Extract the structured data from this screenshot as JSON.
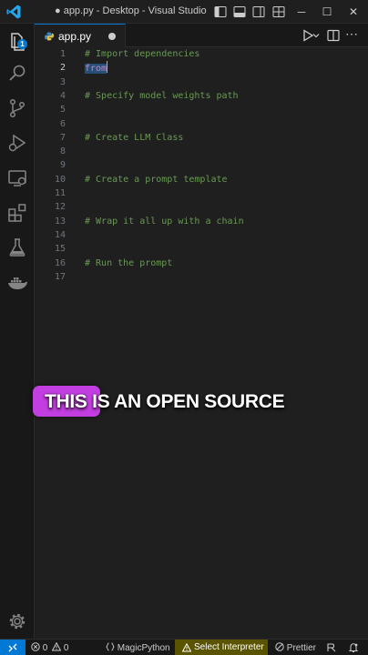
{
  "window": {
    "title": "● app.py - Desktop - Visual Studio C...",
    "controls": {
      "minimize": "─",
      "maximize": "☐",
      "close": "✕"
    }
  },
  "activity_bar": {
    "items": [
      "explorer-icon",
      "search-icon",
      "source-control-icon",
      "run-debug-icon",
      "remote-explorer-icon",
      "extensions-icon",
      "testing-icon",
      "docker-icon"
    ],
    "explorer_badge": "1",
    "bottom_items": [
      "manage-gear-icon"
    ]
  },
  "tabs": [
    {
      "label": "app.py",
      "modified": true,
      "active": true
    }
  ],
  "editor": {
    "lines": [
      {
        "n": "1",
        "text": "# Import dependencies",
        "kind": "comment"
      },
      {
        "n": "2",
        "text": "from",
        "kind": "keyword-selected"
      },
      {
        "n": "3",
        "text": "",
        "kind": "empty"
      },
      {
        "n": "4",
        "text": "# Specify model weights path",
        "kind": "comment"
      },
      {
        "n": "5",
        "text": "",
        "kind": "empty"
      },
      {
        "n": "6",
        "text": "",
        "kind": "empty"
      },
      {
        "n": "7",
        "text": "# Create LLM Class",
        "kind": "comment"
      },
      {
        "n": "8",
        "text": "",
        "kind": "empty"
      },
      {
        "n": "9",
        "text": "",
        "kind": "empty"
      },
      {
        "n": "10",
        "text": "# Create a prompt template",
        "kind": "comment"
      },
      {
        "n": "11",
        "text": "",
        "kind": "empty"
      },
      {
        "n": "12",
        "text": "",
        "kind": "empty"
      },
      {
        "n": "13",
        "text": "# Wrap it all up with a chain",
        "kind": "comment"
      },
      {
        "n": "14",
        "text": "",
        "kind": "empty"
      },
      {
        "n": "15",
        "text": "",
        "kind": "empty"
      },
      {
        "n": "16",
        "text": "# Run the prompt",
        "kind": "comment"
      },
      {
        "n": "17",
        "text": "",
        "kind": "empty"
      }
    ],
    "active_line": "2"
  },
  "caption": {
    "highlight": "THIS",
    "rest": " IS AN OPEN SOURCE"
  },
  "statusbar": {
    "errors": "0",
    "warnings": "0",
    "extension": "MagicPython",
    "interpreter": "Select Interpreter",
    "formatter": "Prettier"
  },
  "colors": {
    "accent": "#0078d4",
    "comment": "#6a9955",
    "keyword": "#c586c0",
    "caption_highlight": "#c23ee0",
    "interpreter_warning_bg": "#5a5300"
  }
}
